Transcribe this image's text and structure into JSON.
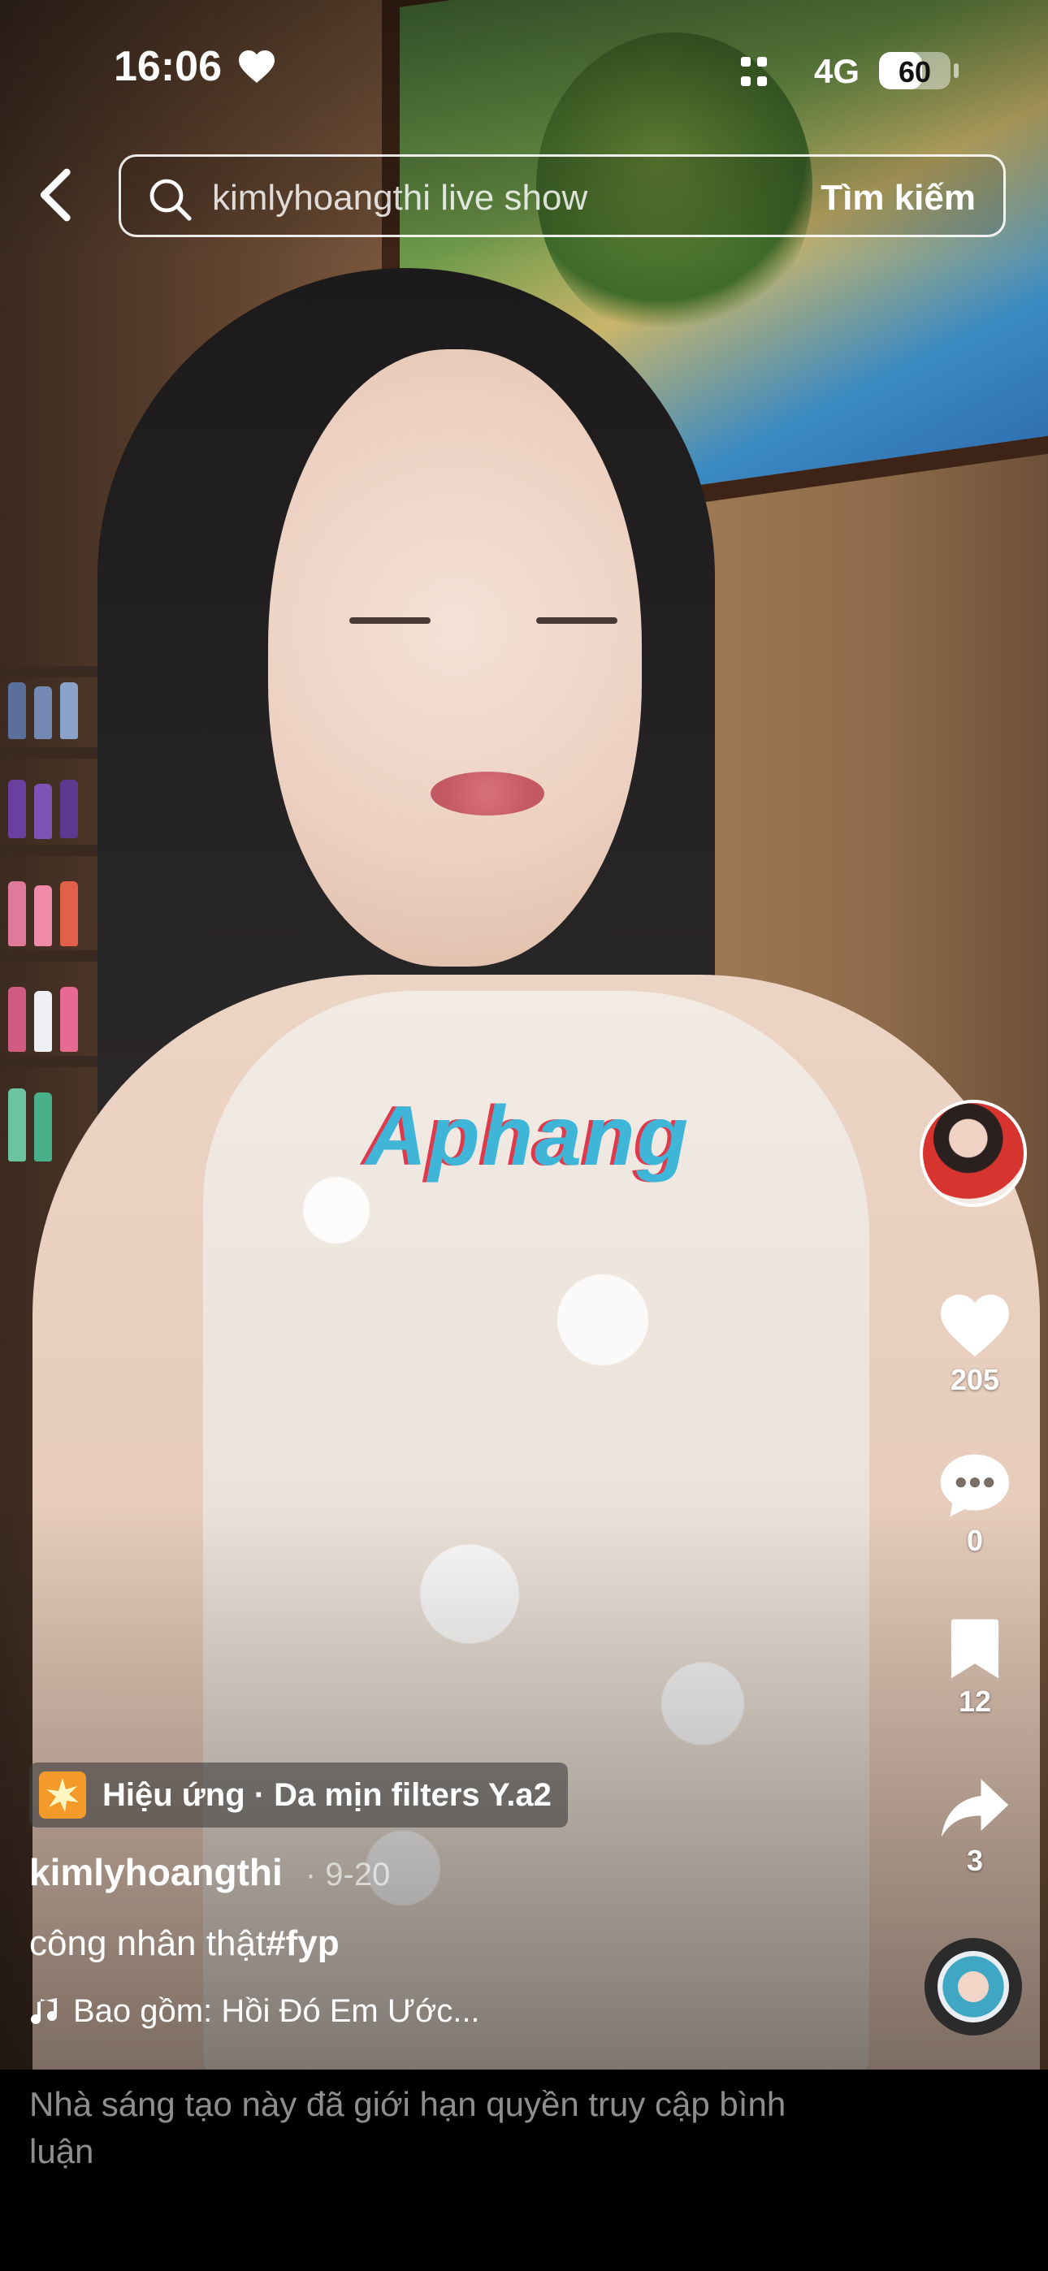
{
  "status_bar": {
    "time": "16:06",
    "network": "4G",
    "battery_level": "60"
  },
  "search": {
    "query": "kimlyhoangthi live show",
    "submit_label": "Tìm kiếm"
  },
  "video": {
    "watermark": "Aphang"
  },
  "right_rail": {
    "likes": "205",
    "comments": "0",
    "saves": "12",
    "shares": "3"
  },
  "post": {
    "effect_label": "Hiệu ứng · Da mịn filters Y.a2",
    "author": "kimlyhoangthi",
    "date": "· 9-20",
    "caption_text": "công nhân thật",
    "caption_hashtag": "#fyp",
    "music": "Bao gồm: Hồi Đó Em Ước..."
  },
  "comments_notice": "Nhà sáng tạo này đã giới hạn quyền truy cập bình luận",
  "colors": {
    "accent_watermark_blue": "#3fb6d8",
    "accent_watermark_red": "#e0394b",
    "effect_icon": "#f39a2a",
    "notice_gray": "#8e8e8e"
  },
  "icons": [
    "heart-icon",
    "grid-icon",
    "back-chevron-icon",
    "search-icon",
    "like-heart-icon",
    "comment-icon",
    "bookmark-icon",
    "share-icon",
    "music-note-icon",
    "effect-icon"
  ]
}
